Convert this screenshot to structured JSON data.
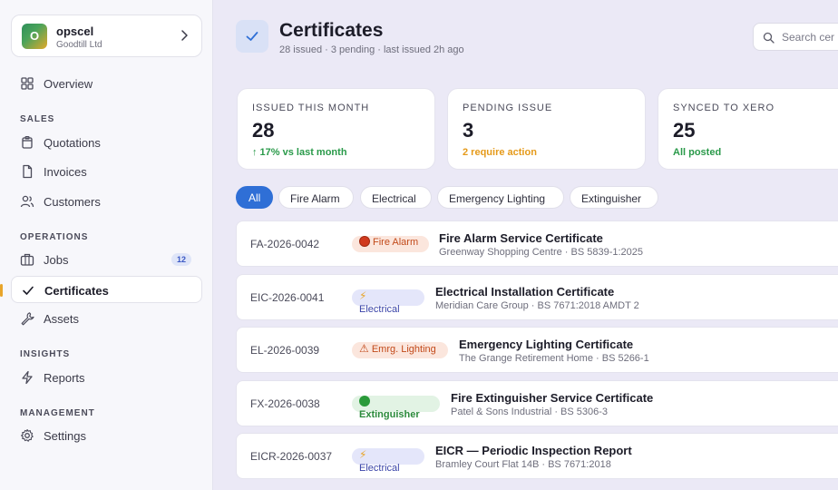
{
  "org": {
    "initial": "O",
    "name": "opscel",
    "subtitle": "Goodtill Ltd"
  },
  "nav": {
    "overview": "Overview",
    "sales_label": "SALES",
    "quotations": "Quotations",
    "invoices": "Invoices",
    "customers": "Customers",
    "operations_label": "OPERATIONS",
    "jobs": "Jobs",
    "jobs_badge": "12",
    "certificates": "Certificates",
    "assets": "Assets",
    "insights_label": "INSIGHTS",
    "reports": "Reports",
    "management_label": "MANAGEMENT",
    "settings": "Settings"
  },
  "header": {
    "title": "Certificates",
    "subtitle": "28 issued · 3 pending · last issued 2h ago",
    "search_placeholder": "Search cer"
  },
  "stats": [
    {
      "label": "ISSUED THIS MONTH",
      "value": "28",
      "note": "↑ 17% vs last month",
      "note_color": "#2a9a4a"
    },
    {
      "label": "PENDING ISSUE",
      "value": "3",
      "note": "2 require action",
      "note_color": "#e59a1a"
    },
    {
      "label": "SYNCED TO XERO",
      "value": "25",
      "note": "All posted",
      "note_color": "#2a9a4a"
    }
  ],
  "filters": [
    "All",
    "Fire Alarm",
    "Electrical",
    "Emergency Lighting",
    "Extinguisher"
  ],
  "certificates": [
    {
      "id": "FA-2026-0042",
      "tag_icon": "fire-icon",
      "tag": "Fire Alarm",
      "title": "Fire Alarm Service Certificate",
      "meta": "Greenway Shopping Centre · BS 5839-1:2025"
    },
    {
      "id": "EIC-2026-0041",
      "tag_icon": "lightning-icon",
      "tag": "Electrical",
      "title": "Electrical Installation Certificate",
      "meta": "Meridian Care Group · BS 7671:2018 AMDT 2"
    },
    {
      "id": "EL-2026-0039",
      "tag_icon": "warning-icon",
      "tag": "Emrg. Lighting",
      "title": "Emergency Lighting Certificate",
      "meta": "The Grange Retirement Home · BS 5266-1"
    },
    {
      "id": "FX-2026-0038",
      "tag_icon": "green-dot-icon",
      "tag": "Extinguisher",
      "title": "Fire Extinguisher Service Certificate",
      "meta": "Patel & Sons Industrial · BS 5306-3"
    },
    {
      "id": "EICR-2026-0037",
      "tag_icon": "lightning-icon",
      "tag": "Electrical",
      "title": "EICR — Periodic Inspection Report",
      "meta": "Bramley Court Flat 14B · BS 7671:2018"
    }
  ]
}
